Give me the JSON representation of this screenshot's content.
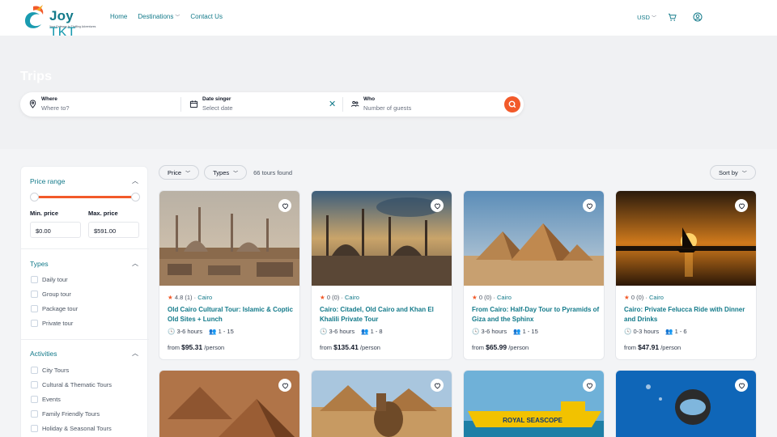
{
  "brand": {
    "name_main": "Joy",
    "name_accent": "TKT",
    "tagline": "Your Gateway to Thrilling Adventures"
  },
  "nav": {
    "home": "Home",
    "destinations": "Destinations",
    "contact": "Contact Us"
  },
  "header_right": {
    "currency": "USD"
  },
  "hero": {
    "title": "Trips"
  },
  "search": {
    "where_label": "Where",
    "where_placeholder": "Where to?",
    "date_label": "Date singer",
    "date_placeholder": "Select date",
    "who_label": "Who",
    "who_placeholder": "Number of guests"
  },
  "sidebar": {
    "price_range_title": "Price range",
    "min_label": "Min. price",
    "min_value": "$0.00",
    "max_label": "Max. price",
    "max_value": "$591.00",
    "slider_fraction": [
      0.0,
      1.0
    ],
    "types_title": "Types",
    "types": [
      "Daily tour",
      "Group tour",
      "Package tour",
      "Private tour"
    ],
    "activities_title": "Activities",
    "activities": [
      "City Tours",
      "Cultural & Thematic Tours",
      "Events",
      "Family Friendly Tours",
      "Holiday & Seasonal Tours"
    ]
  },
  "toolbar": {
    "price_filter": "Price",
    "types_filter": "Types",
    "found": "66 tours found",
    "sort": "Sort by"
  },
  "cards": [
    {
      "rating": "4.8",
      "reviews": "(1)",
      "location": "Cairo",
      "title": "Old Cairo Cultural Tour: Islamic & Coptic Old Sites + Lunch",
      "duration": "3-6 hours",
      "group": "1 - 15",
      "price_from": "from",
      "price": "$95.31",
      "per": "/person"
    },
    {
      "rating": "0",
      "reviews": "(0)",
      "location": "Cairo",
      "title": "Cairo: Citadel, Old Cairo and Khan El Khalili Private Tour",
      "duration": "3-6 hours",
      "group": "1 - 8",
      "price_from": "from",
      "price": "$135.41",
      "per": "/person"
    },
    {
      "rating": "0",
      "reviews": "(0)",
      "location": "Cairo",
      "title": "From Cairo: Half-Day Tour to Pyramids of Giza and the Sphinx",
      "duration": "3-6 hours",
      "group": "1 - 15",
      "price_from": "from",
      "price": "$65.99",
      "per": "/person"
    },
    {
      "rating": "0",
      "reviews": "(0)",
      "location": "Cairo",
      "title": "Cairo: Private Felucca Ride with Dinner and Drinks",
      "duration": "0-3 hours",
      "group": "1 - 6",
      "price_from": "from",
      "price": "$47.91",
      "per": "/person"
    }
  ],
  "row2_banner": {
    "boat_text": "ROYAL SEASCOPE"
  },
  "colors": {
    "brand": "#137a8a",
    "accent": "#f25a2a"
  }
}
